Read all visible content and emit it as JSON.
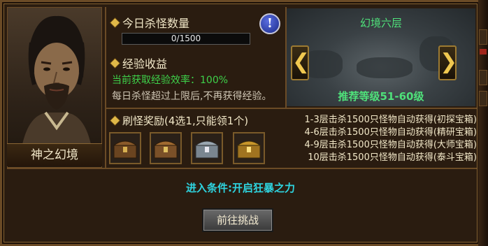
{
  "portrait": {
    "name": "神之幻境"
  },
  "kill_count": {
    "title": "今日杀怪数量",
    "progress_text": "0/1500",
    "progress_value": 0,
    "progress_max": 1500,
    "info_label": "!"
  },
  "experience": {
    "title": "经验收益",
    "efficiency": "当前获取经验效率：100%",
    "note": "每日杀怪超过上限后,不再获得经验。"
  },
  "map": {
    "title": "幻境六层",
    "recommended_level": "推荐等级51-60级",
    "prev_label": "❮",
    "next_label": "❯"
  },
  "rewards": {
    "title": "刷怪奖励(4选1,只能领1个)",
    "chests": [
      {
        "name": "初探宝箱",
        "color": "#8a5a2a"
      },
      {
        "name": "精研宝箱",
        "color": "#a06a30"
      },
      {
        "name": "大师宝箱",
        "color": "#9aa6b0"
      },
      {
        "name": "泰斗宝箱",
        "color": "#c8962a"
      }
    ],
    "lines": [
      "1-3层击杀1500只怪物自动获得(初探宝箱)",
      "4-6层击杀1500只怪物自动获得(精研宝箱)",
      "4-9层击杀1500只怪物自动获得(大师宝箱)",
      "10层击杀1500只怪物自动获得(泰斗宝箱)"
    ]
  },
  "condition": "进入条件:开启狂暴之力",
  "challenge_button": "前往挑战"
}
